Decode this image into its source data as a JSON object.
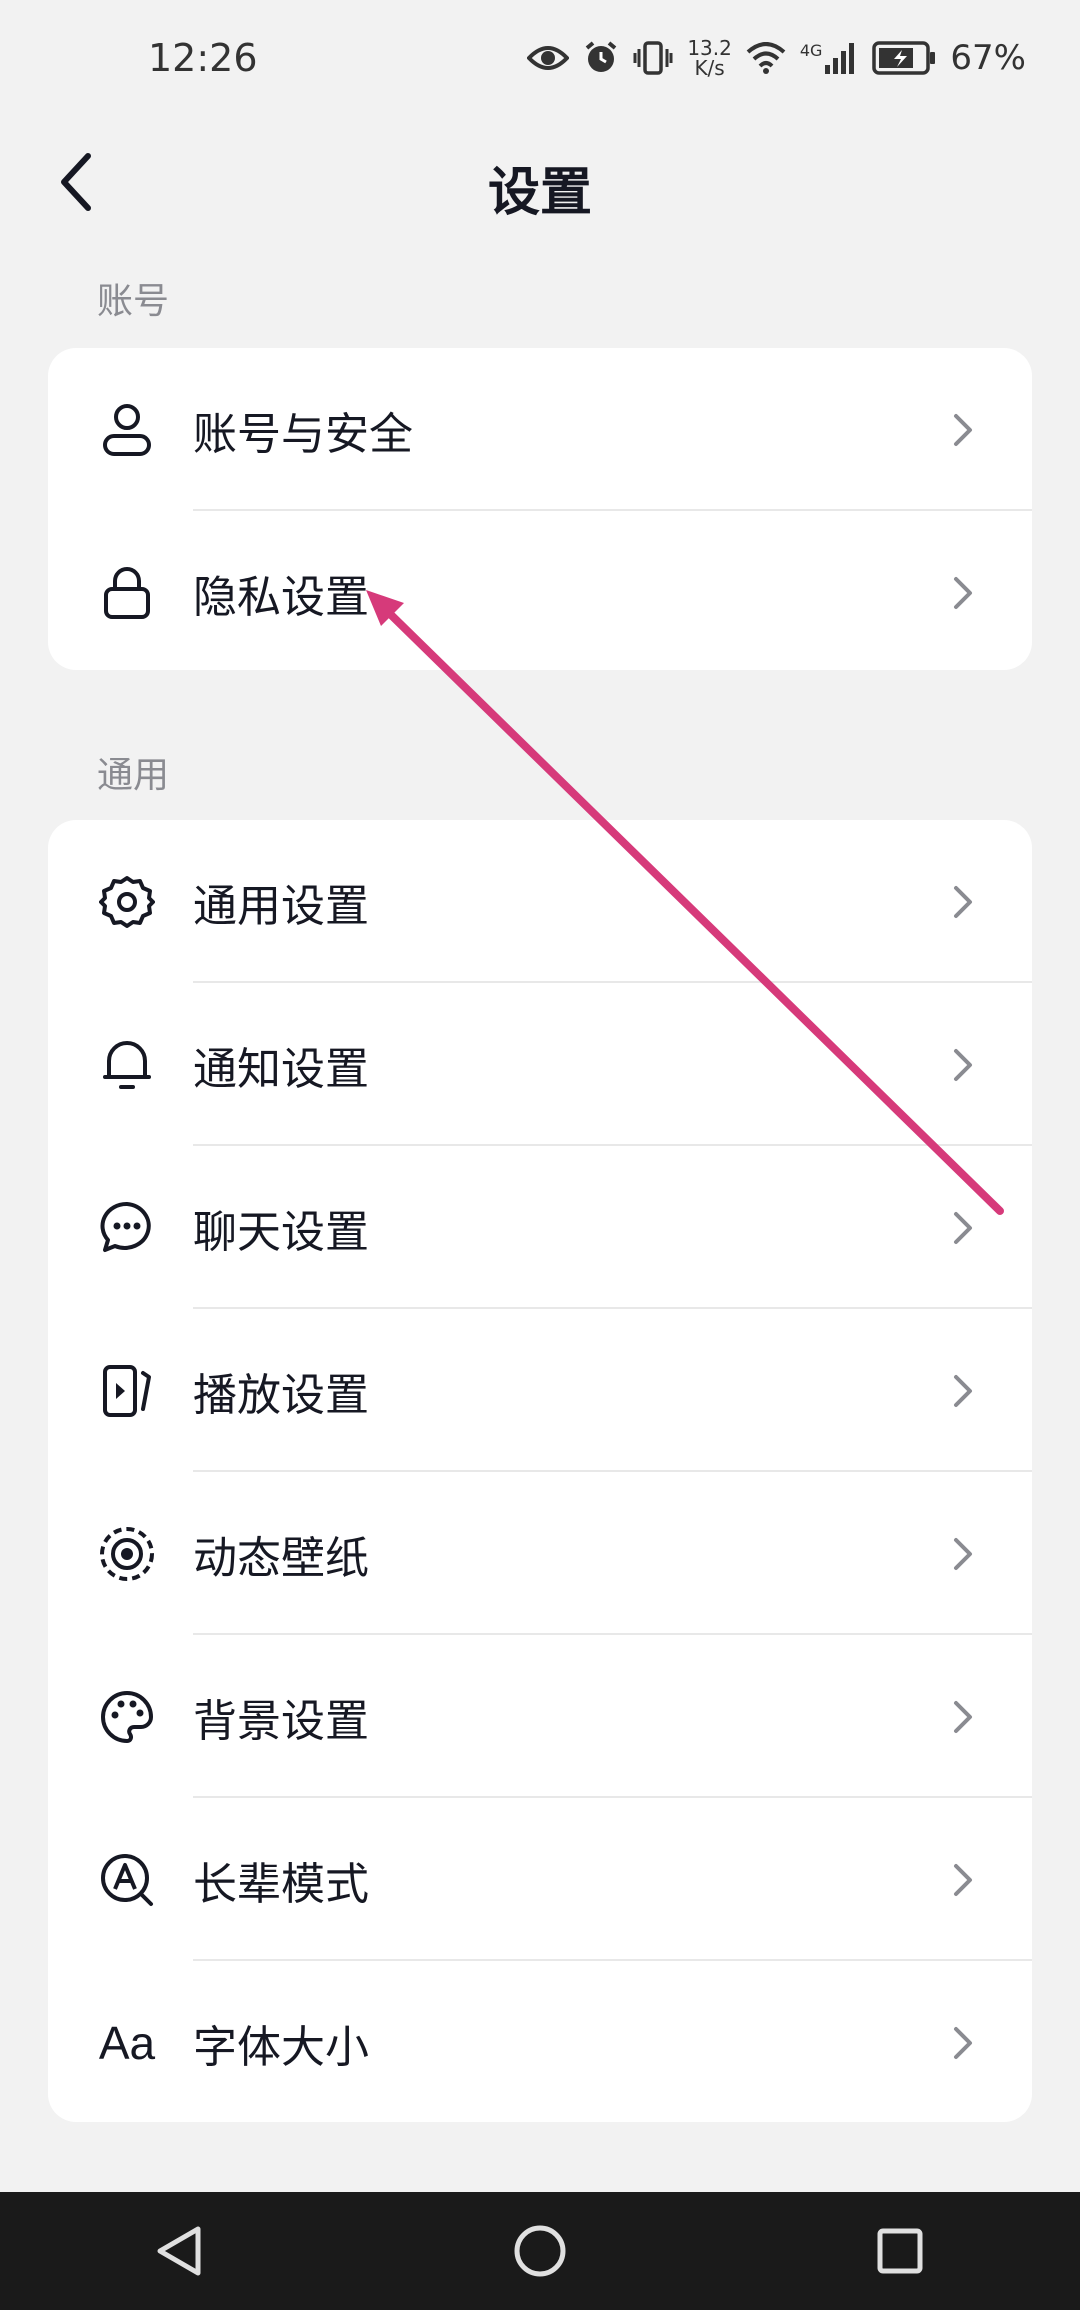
{
  "status_bar": {
    "time": "12:26",
    "net_speed_value": "13.2",
    "net_speed_unit": "K/s",
    "network_type": "4G",
    "battery_percent": "67%"
  },
  "header": {
    "title": "设置"
  },
  "sections": {
    "account": {
      "label": "账号",
      "items": [
        {
          "label": "账号与安全",
          "icon": "user-icon"
        },
        {
          "label": "隐私设置",
          "icon": "lock-icon"
        }
      ]
    },
    "general": {
      "label": "通用",
      "items": [
        {
          "label": "通用设置",
          "icon": "gear-icon"
        },
        {
          "label": "通知设置",
          "icon": "bell-icon"
        },
        {
          "label": "聊天设置",
          "icon": "chat-icon"
        },
        {
          "label": "播放设置",
          "icon": "play-icon"
        },
        {
          "label": "动态壁纸",
          "icon": "live-wallpaper-icon"
        },
        {
          "label": "背景设置",
          "icon": "palette-icon"
        },
        {
          "label": "长辈模式",
          "icon": "elder-mode-icon"
        },
        {
          "label": "字体大小",
          "icon": "font-size-icon",
          "icon_text": "Aa"
        }
      ]
    }
  },
  "annotation": {
    "color": "#d63a7a"
  }
}
